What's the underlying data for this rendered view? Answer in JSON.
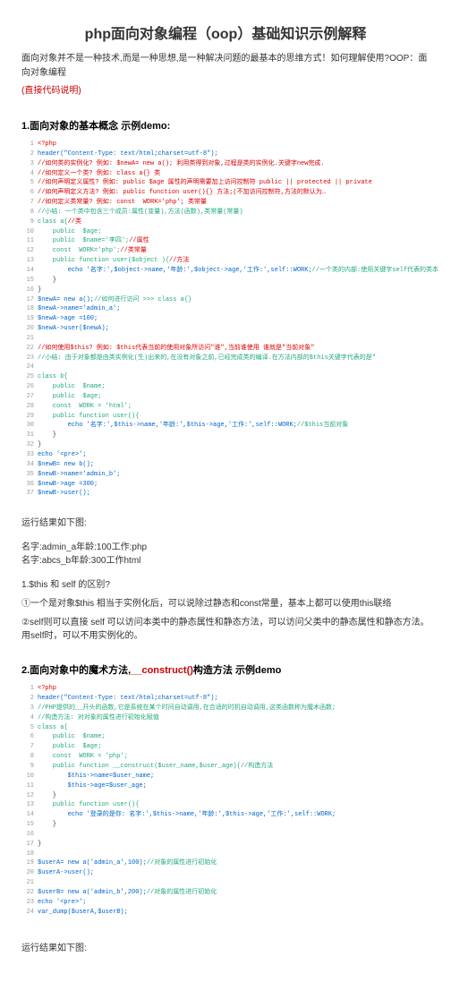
{
  "title": "php面向对象编程（oop）基础知识示例解释",
  "intro": "面向对象并不是一种技术,而是一种思想,是一种解决问题的最基本的思维方式！如何理解使用?OOP：面向对象编程",
  "introLink": "(直接代码说明)",
  "sec1": "1.面向对象的基本概念 示例demo:",
  "code1": {
    "l1": "<?php",
    "l2": "header(\"Content-Type: text/html;charset=utf-8\");",
    "l3": "//如何类的实例化? 例如: $newA= new a(); 利用类得到对象,过程是类的实例化.关键字new完成.",
    "l4": "//如何定义一个类? 例如: class a{} 类",
    "l5": "//如何声明定义属性? 例如: public $age 属性的声明需要加上访问控制符 public || protected || private",
    "l6": "//如何声明定义方法? 例如: public function user(){} 方法;(不加访问控制符,方法的默认为…",
    "l7": "//如何定义类常量? 例如: const  WORK='php'; 类常量",
    "l8": "//小结: 一个类中包含三个成员:属性(变量),方法(函数),类常量(常量)",
    "l9": "class a{",
    "l10": "//类",
    "l10b": "    public  $age;",
    "l11": "//属性",
    "l11b": "    public  $name='李四';",
    "l12": "    const  WORK='php';",
    "l13": "//类常量",
    "l13b": "    public function user($object ){",
    "l14": "//方法",
    "l14b": "        echo '名字:',$object->name,'年龄:',$object->age,'工作:',self::WORK;",
    "l14c": "//一个类的内部:使用关键字self代表的类本",
    "l15": "    }",
    "l16": "}",
    "l17": "$newA= new a();",
    "l17b": "//如何进行访问 >>> class a{}",
    "l18": "$newA->name='admin_a';",
    "l19": "$newA->age =100;",
    "l20": "$newA->user($newA);",
    "l21": "",
    "l22": "//如何使用$this? 例如: $this代表当前的使用对象所访问\"谁\",当前谁使用 谁就是\"当前对象\"",
    "l23": "//小结: 由于对象都是由类实例化(生)出来的,在没有对象之前,已经完成类的编译.在方法内部的$this关键字代表的是\"",
    "l24": "",
    "l25": "class b{",
    "l26": "    public  $name;",
    "l27": "    public  $age;",
    "l28": "    const  WORK = 'html';",
    "l29": "    public function user(){",
    "l30": "        echo '名字:',$this->name,'年龄:',$this->age,'工作:',self::WORK;",
    "l30b": "//$this当前对象",
    "l31": "    }",
    "l32": "}",
    "l33": "echo '<pre>';",
    "l34": "$newB= new b();",
    "l35": "$newB->name='admin_b';",
    "l36": "$newB->age =300;",
    "l37": "$newB->user();"
  },
  "run1": "运行结果如下图:",
  "result1a": "名字:admin_a年龄:100工作:php",
  "result1b": "名字:abcs_b年龄:300工作html",
  "note1a": "1.$this 和 self 的区别?",
  "note1b": "①一个是对象$this 相当于实例化后，可以说除过静态和const常量，基本上都可以使用this联络",
  "note1c": "②self则可以直接 self 可以访问本类中的静态属性和静态方法，可以访问父类中的静态属性和静态方法。用self时，可以不用实例化的。",
  "sec2": "2.面向对象中的魔术方法,__construct()构造方法 示例demo",
  "code2": {
    "l1": "<?php",
    "l2": "header(\"Content-Type: text/html;charset=utf-8\");",
    "l3": "//PHP提供的__开头的函数,它是系统在某个时间自动调用,在合适的时机自动调用,这类函数称为魔术函数;",
    "l4": "//构造方法: 对对象的属性进行初始化赋值",
    "l5": "class a{",
    "l6": "    public  $name;",
    "l7": "    public  $age;",
    "l8": "    const  WORK = 'php';",
    "l9": "    public function __construct($user_name,$user_age){",
    "l9b": "//构造方法",
    "l10": "        $this->name=$user_name;",
    "l11": "        $this->age=$user_age;",
    "l12": "    }",
    "l13": "    public function user(){",
    "l14": "        echo '登录的是你: 名字:',$this->name,'年龄:',$this->age,'工作:',self::WORK;",
    "l15": "    }",
    "l16": "",
    "l17": "}",
    "l18": "",
    "l19": "$userA= new a('admin_a',100);",
    "l19b": "//对象的属性进行初始化",
    "l20": "$userA->user();",
    "l21": "",
    "l22": "$userB= new a('admin_b',200);",
    "l22b": "//对象的属性进行初始化",
    "l23": "echo '<pre>';",
    "l24": "var_dump($userA,$userB);"
  },
  "run2": "运行结果如下图:"
}
